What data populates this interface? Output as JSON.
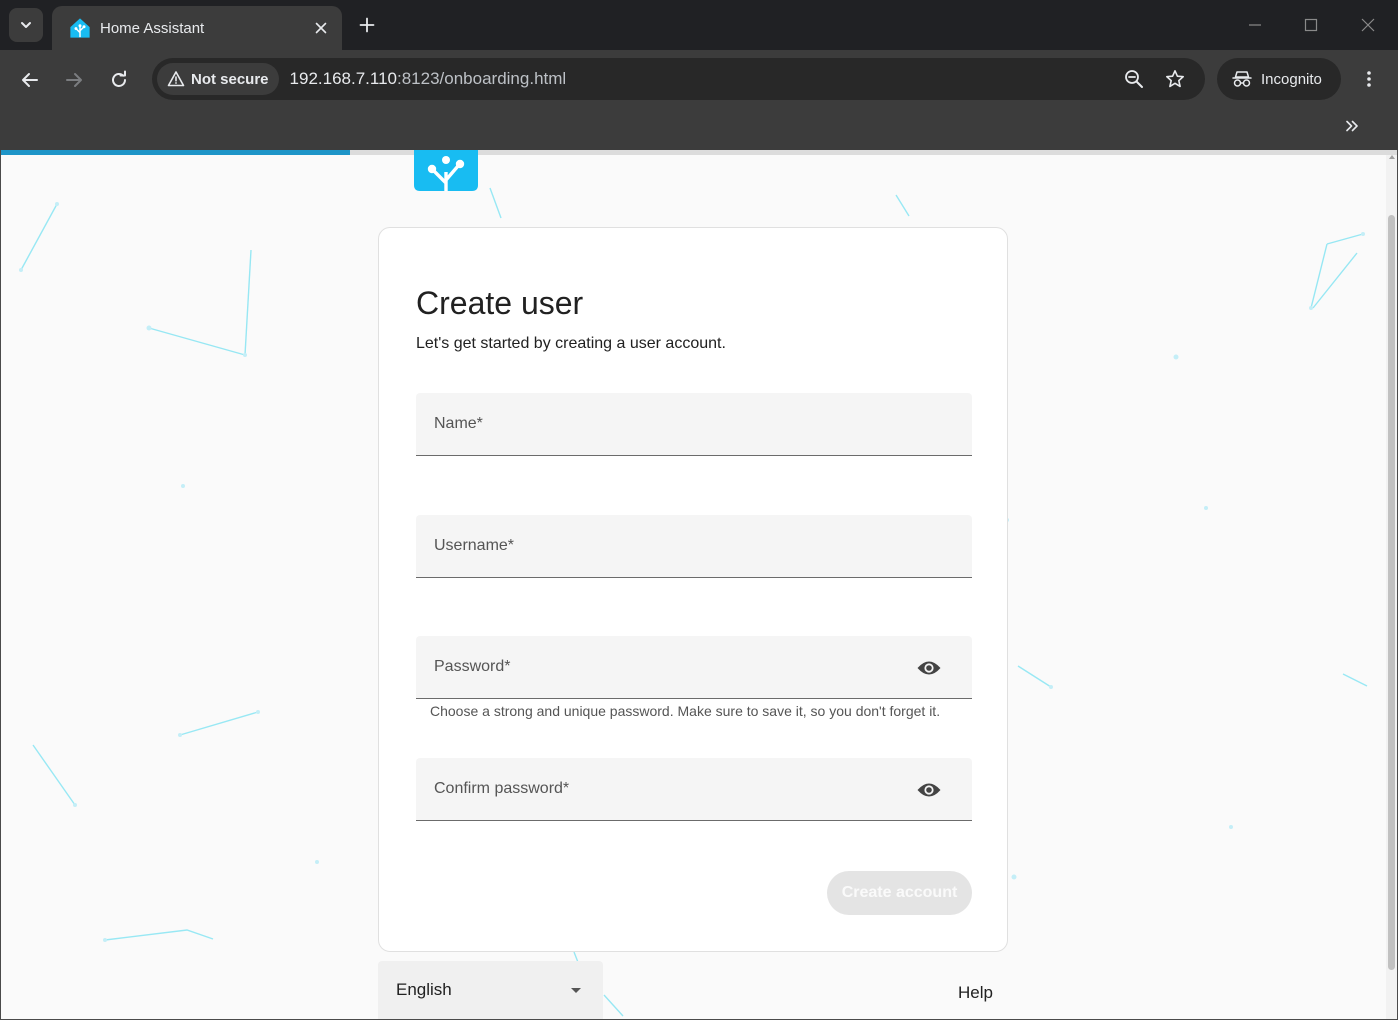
{
  "browser": {
    "tab": {
      "title": "Home Assistant"
    },
    "omnibox": {
      "security_label": "Not secure",
      "url_host": "192.168.7.110",
      "url_rest": ":8123/onboarding.html"
    },
    "profile_label": "Incognito",
    "progress": 0.25
  },
  "card": {
    "title": "Create user",
    "subtitle": "Let's get started by creating a user account.",
    "fields": {
      "name": {
        "label": "Name*",
        "value": ""
      },
      "username": {
        "label": "Username*",
        "value": ""
      },
      "password": {
        "label": "Password*",
        "value": "",
        "helper": "Choose a strong and unique password. Make sure to save it, so you don't forget it."
      },
      "confirm": {
        "label": "Confirm password*",
        "value": ""
      }
    },
    "submit_label": "Create account"
  },
  "footer": {
    "language": "English",
    "help_label": "Help"
  },
  "colors": {
    "accent": "#18bcf2",
    "progress": "#1e95c8",
    "button_disabled": "#e4e4e4"
  }
}
